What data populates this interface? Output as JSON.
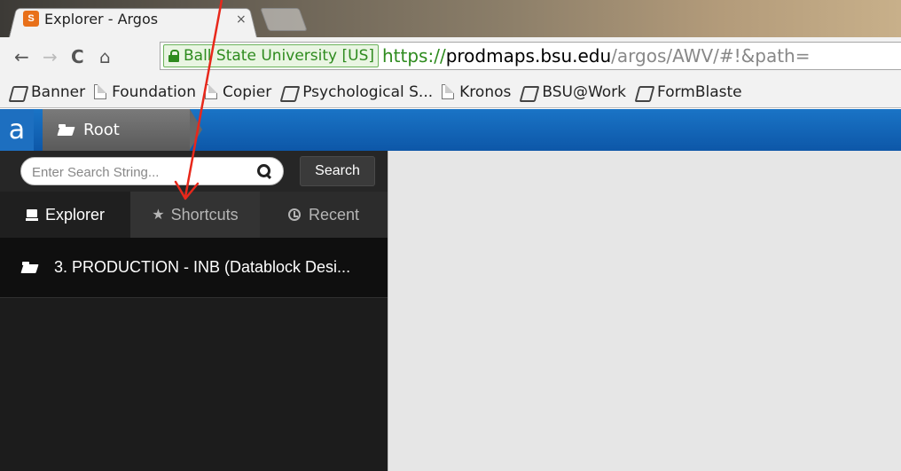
{
  "browser": {
    "tab_title": "Explorer - Argos",
    "tab_close": "×",
    "favicon_text": "S",
    "nav": {
      "back": "←",
      "forward": "→",
      "reload": "C",
      "home": "⌂"
    },
    "ev_label": "Ball State University [US]",
    "url": {
      "scheme": "https://",
      "host": "prodmaps.bsu.edu",
      "path": "/argos/AWV/#!&path="
    },
    "bookmarks": [
      {
        "label": "Banner",
        "icon": "argos-icon"
      },
      {
        "label": "Foundation",
        "icon": "page-icon"
      },
      {
        "label": "Copier",
        "icon": "page-icon"
      },
      {
        "label": "Psychological S...",
        "icon": "argos-icon"
      },
      {
        "label": "Kronos",
        "icon": "page-icon"
      },
      {
        "label": "BSU@Work",
        "icon": "argos-icon"
      },
      {
        "label": "FormBlaste",
        "icon": "argos-icon"
      }
    ]
  },
  "app": {
    "logo": "a",
    "breadcrumb_root": "Root",
    "search": {
      "placeholder": "Enter Search String...",
      "button_label": "Search"
    },
    "tabs": {
      "explorer": "Explorer",
      "shortcuts": "Shortcuts",
      "recent": "Recent"
    },
    "tree_items": [
      {
        "label": "3. PRODUCTION - INB (Datablock Desi..."
      }
    ]
  },
  "colors": {
    "header_blue": "#0d57a8",
    "annotation_red": "#e8281b",
    "ev_green": "#2e8b1e"
  }
}
